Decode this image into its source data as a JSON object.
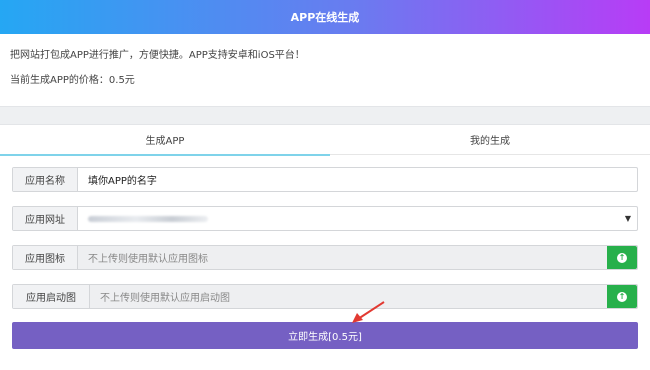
{
  "header": {
    "title": "APP在线生成"
  },
  "intro": {
    "line1": "把网站打包成APP进行推广，方便快捷。APP支持安卓和iOS平台！",
    "line2": "当前生成APP的价格：0.5元"
  },
  "tabs": [
    {
      "label": "生成APP",
      "active": true
    },
    {
      "label": "我的生成",
      "active": false
    }
  ],
  "form": {
    "app_name": {
      "label": "应用名称",
      "value": "填你APP的名字"
    },
    "app_url": {
      "label": "应用网址",
      "value": "",
      "blurred": true
    },
    "app_icon": {
      "label": "应用图标",
      "placeholder": "不上传则使用默认应用图标"
    },
    "app_splash": {
      "label": "应用启动图",
      "placeholder": "不上传则使用默认应用启动图"
    }
  },
  "submit": {
    "label": "立即生成[0.5元]"
  },
  "colors": {
    "accent": "#7560c3",
    "upload": "#27b04b",
    "annotation_arrow": "#e23a32"
  }
}
